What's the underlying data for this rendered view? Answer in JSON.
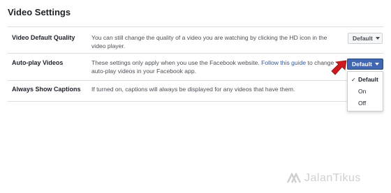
{
  "page_title": "Video Settings",
  "rows": [
    {
      "label": "Video Default Quality",
      "description": "You can still change the quality of a video you are watching by clicking the HD icon in the video player.",
      "select_value": "Default"
    },
    {
      "label": "Auto-play Videos",
      "description_before": "These settings only apply when you use the Facebook website. ",
      "description_link": "Follow this guide",
      "description_after": " to change auto-play videos in your Facebook app.",
      "select_value": "Default"
    },
    {
      "label": "Always Show Captions",
      "description": "If turned on, captions will always be displayed for any videos that have them."
    }
  ],
  "dropdown": {
    "options": [
      {
        "label": "Default",
        "selected": true
      },
      {
        "label": "On",
        "selected": false
      },
      {
        "label": "Off",
        "selected": false
      }
    ],
    "check_glyph": "✓"
  },
  "watermark": "JalanTikus",
  "colors": {
    "fb_blue": "#4267b2",
    "link": "#365899",
    "arrow_red": "#d0181f"
  },
  "icons": {
    "pointer": "red-pointer-arrow-icon",
    "watermark_logo": "jalantikus-logo-icon"
  }
}
